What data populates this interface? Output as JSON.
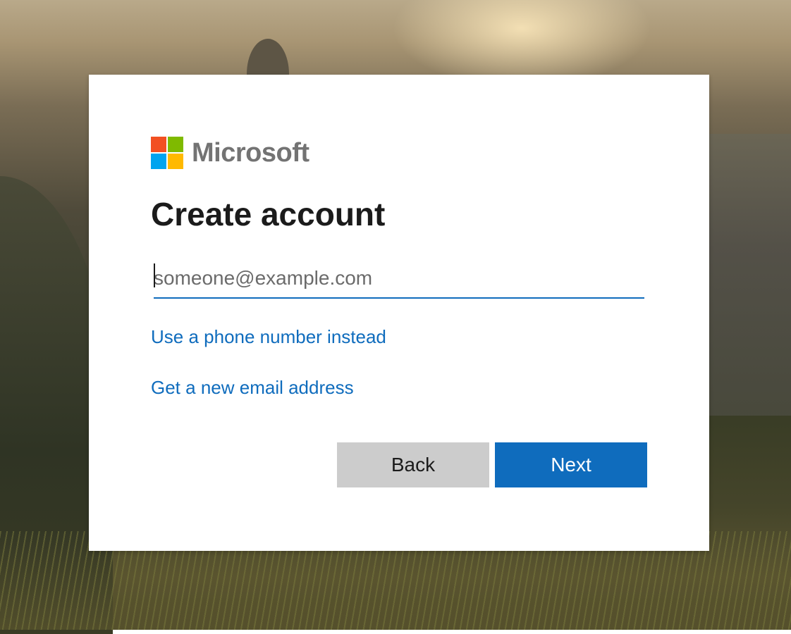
{
  "colors": {
    "accent": "#0f6cbd",
    "back_button_bg": "#cccccc",
    "logo_red": "#f25022",
    "logo_green": "#7fba00",
    "logo_blue": "#00a4ef",
    "logo_yellow": "#ffb900",
    "logo_text": "#737373"
  },
  "logo": {
    "icon": "microsoft-logo-icon",
    "text": "Microsoft"
  },
  "title": "Create account",
  "email_field": {
    "value": "",
    "placeholder": "someone@example.com"
  },
  "links": {
    "phone": "Use a phone number instead",
    "new_email": "Get a new email address"
  },
  "buttons": {
    "back": "Back",
    "next": "Next"
  }
}
